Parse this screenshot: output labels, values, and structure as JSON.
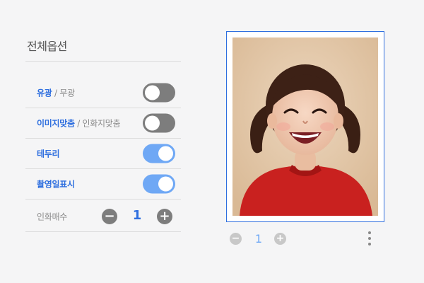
{
  "panel": {
    "title": "전체옵션",
    "gloss": {
      "on_label": "유광",
      "separator": "/",
      "off_label": "무광",
      "state": "off"
    },
    "fit": {
      "on_label": "이미지맞춤",
      "separator": "/",
      "off_label": "인화지맞춤",
      "state": "off"
    },
    "border": {
      "label": "테두리",
      "state": "on"
    },
    "date": {
      "label": "촬영일표시",
      "state": "on"
    },
    "quantity": {
      "label": "인화매수",
      "value": "1",
      "minus": "−",
      "plus": "+"
    }
  },
  "photo": {
    "subject": "smiling child in red shirt with pigtails",
    "quantity": {
      "value": "1",
      "minus": "−",
      "plus": "+"
    },
    "more_icon": "more-vertical-icon"
  },
  "colors": {
    "accent": "#2f6fdf",
    "toggle_on": "#6fa8f5",
    "toggle_off": "#7d7d7d",
    "background": "#f5f5f6"
  }
}
